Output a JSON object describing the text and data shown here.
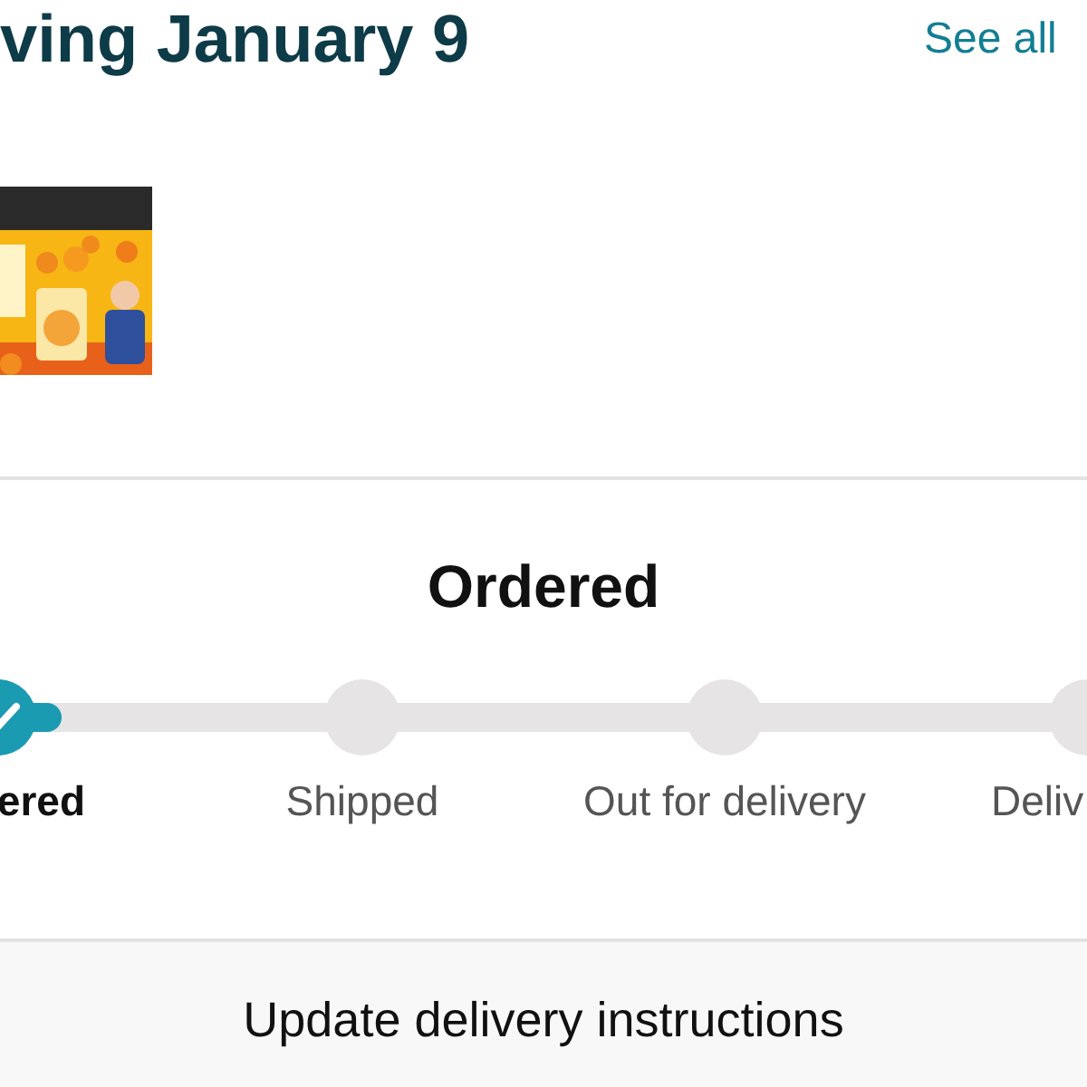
{
  "header": {
    "title": "ving January 9",
    "link": "See all"
  },
  "status": {
    "title": "Ordered"
  },
  "steps": [
    {
      "label": "ered",
      "completed": true,
      "selected": true
    },
    {
      "label": "Shipped",
      "completed": false,
      "selected": false
    },
    {
      "label": "Out for delivery",
      "completed": false,
      "selected": false
    },
    {
      "label": "Deliv",
      "completed": false,
      "selected": false
    }
  ],
  "action": {
    "label": "Update delivery instructions"
  }
}
